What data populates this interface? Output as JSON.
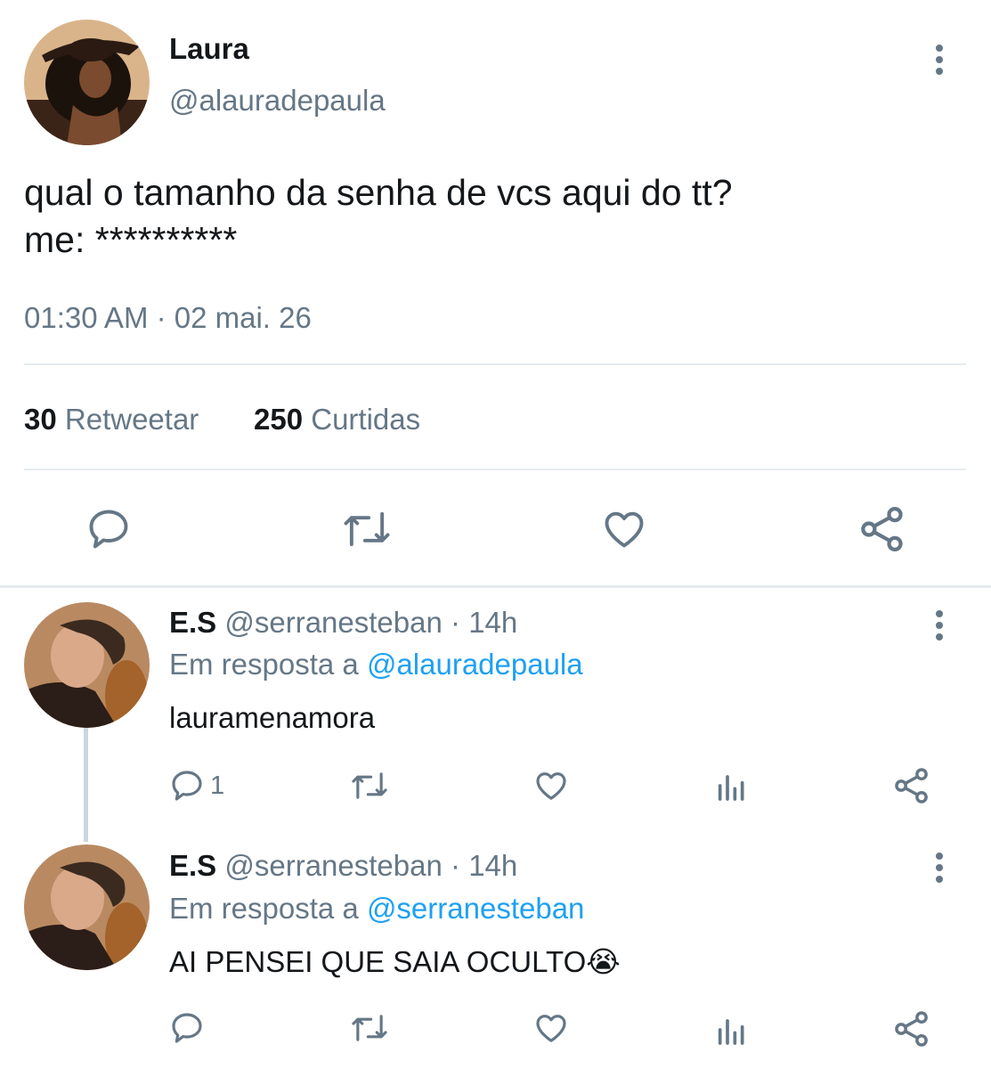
{
  "main_tweet": {
    "display_name": "Laura",
    "handle": "@alauradepaula",
    "text_line1": "qual o tamanho da senha de vcs aqui do tt?",
    "text_line2": "me: **********",
    "timestamp": "01:30 AM · 02 mai. 26",
    "retweet_count": "30",
    "retweet_label": "Retweetar",
    "like_count": "250",
    "like_label": "Curtidas"
  },
  "replies": [
    {
      "display_name": "E.S",
      "handle": "@serranesteban",
      "time": "· 14h",
      "reply_prefix": "Em resposta a",
      "reply_to": "@alauradepaula",
      "text": "lauramenamora",
      "reply_count": "1"
    },
    {
      "display_name": "E.S",
      "handle": "@serranesteban",
      "time": "· 14h",
      "reply_prefix": "Em resposta a",
      "reply_to": "@serranesteban",
      "text": "AI PENSEI QUE SAIA OCULTO",
      "emoji": "😭"
    }
  ],
  "colors": {
    "text": "#14171a",
    "secondary": "#657786",
    "link": "#1da1f2",
    "divider": "#e6ecf0"
  },
  "icons": [
    "more-icon",
    "reply-icon",
    "retweet-icon",
    "like-icon",
    "share-icon",
    "analytics-icon",
    "avatar",
    "thread-line"
  ]
}
